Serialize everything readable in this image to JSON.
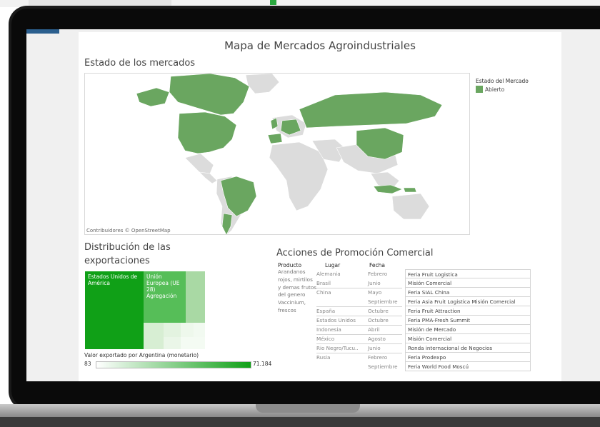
{
  "title": "Mapa de Mercados Agroindustriales",
  "map": {
    "section_title": "Estado de los mercados",
    "attribution": "Contribuidores © OpenStreetMap",
    "legend_title": "Estado del Mercado",
    "legend_item": "Abierto",
    "colors": {
      "open": "#6aa660",
      "other": "#dcdcdc",
      "ocean": "#ffffff"
    }
  },
  "distribution": {
    "section_title_line1": "Distribución de las",
    "section_title_line2": "exportaciones",
    "treemap": {
      "usa": "Estados Unidos de América",
      "ue": "Unión Europea (UE 28) Agregación"
    },
    "color_legend": {
      "title": "Valor exportado por Argentina (monetario)",
      "min": "83",
      "max": "71.184"
    }
  },
  "promo": {
    "section_title": "Acciones de Promoción Comercial",
    "headers": {
      "producto": "Producto",
      "lugar": "Lugar",
      "fecha": "Fecha"
    },
    "producto": "Arandanos rojos, mirtilos y demas frutos del genero Vaccinium, frescos",
    "rows": [
      {
        "lugar": "Alemania",
        "fecha": "Febrero",
        "accion": "Feria Fruit Logistica"
      },
      {
        "lugar": "Brasil",
        "fecha": "Junio",
        "accion": "Misión Comercial"
      },
      {
        "lugar": "China",
        "fecha": "Mayo",
        "accion": "Feria SIAL China"
      },
      {
        "lugar": "",
        "fecha": "Septiembre",
        "accion": "Feria Asia Fruit Logistica   Misión Comercial"
      },
      {
        "lugar": "España",
        "fecha": "Octubre",
        "accion": "Feria Fruit Attraction"
      },
      {
        "lugar": "Estados Unidos",
        "fecha": "Octubre",
        "accion": "Feria PMA-Fresh Summit"
      },
      {
        "lugar": "Indonesia",
        "fecha": "Abril",
        "accion": "Misión de Mercado"
      },
      {
        "lugar": "México",
        "fecha": "Agosto",
        "accion": "Misión Comercial"
      },
      {
        "lugar": "Rio Negro/Tucu..",
        "fecha": "Junio",
        "accion": "Ronda internacional de Negocios"
      },
      {
        "lugar": "Rusia",
        "fecha": "Febrero",
        "accion": "Feria Prodexpo"
      },
      {
        "lugar": "",
        "fecha": "Septiembre",
        "accion": "Feria World Food Moscú"
      }
    ]
  }
}
